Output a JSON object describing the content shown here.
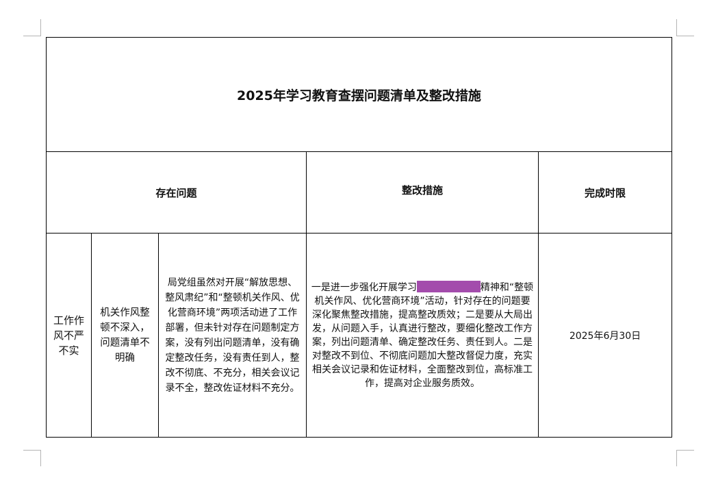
{
  "document": {
    "title": "2025年学习教育查摆问题清单及整改措施",
    "headers": {
      "problem": "存在问题",
      "measures": "整改措施",
      "deadline": "完成时限"
    },
    "row": {
      "category": "工作作风不严不实",
      "sub_category": "机关作风整顿不深入，问题清单不明确",
      "problem_detail": "局党组虽然对开展“解放思想、整风肃纪”和“整顿机关作风、优化营商环境”两项活动进了工作部署，但未针对存在问题制定方案，没有列出问题清单，没有确定整改任务，没有责任到人，整改不彻底、不充分，相关会议记录不全，整改佐证材料不充分。",
      "measures_before": "一是进一步强化开展学习",
      "measures_after": "精神和“整顿机关作风、优化营商环境”活动，针对存在的问题要深化聚焦整改措施，提高整改质效；二是要从大局出发，从问题入手，认真进行整改，要细化整改工作方案，列出问题清单、确定整改任务、责任到人。二是对整改不到位、不彻底问题加大整改督促力度，充实相关会议记录和佐证材料，全面整改到位，高标准工作，提高对企业服务质效。",
      "redaction_color": "#a34cac",
      "deadline": "2025年6月30日"
    }
  }
}
